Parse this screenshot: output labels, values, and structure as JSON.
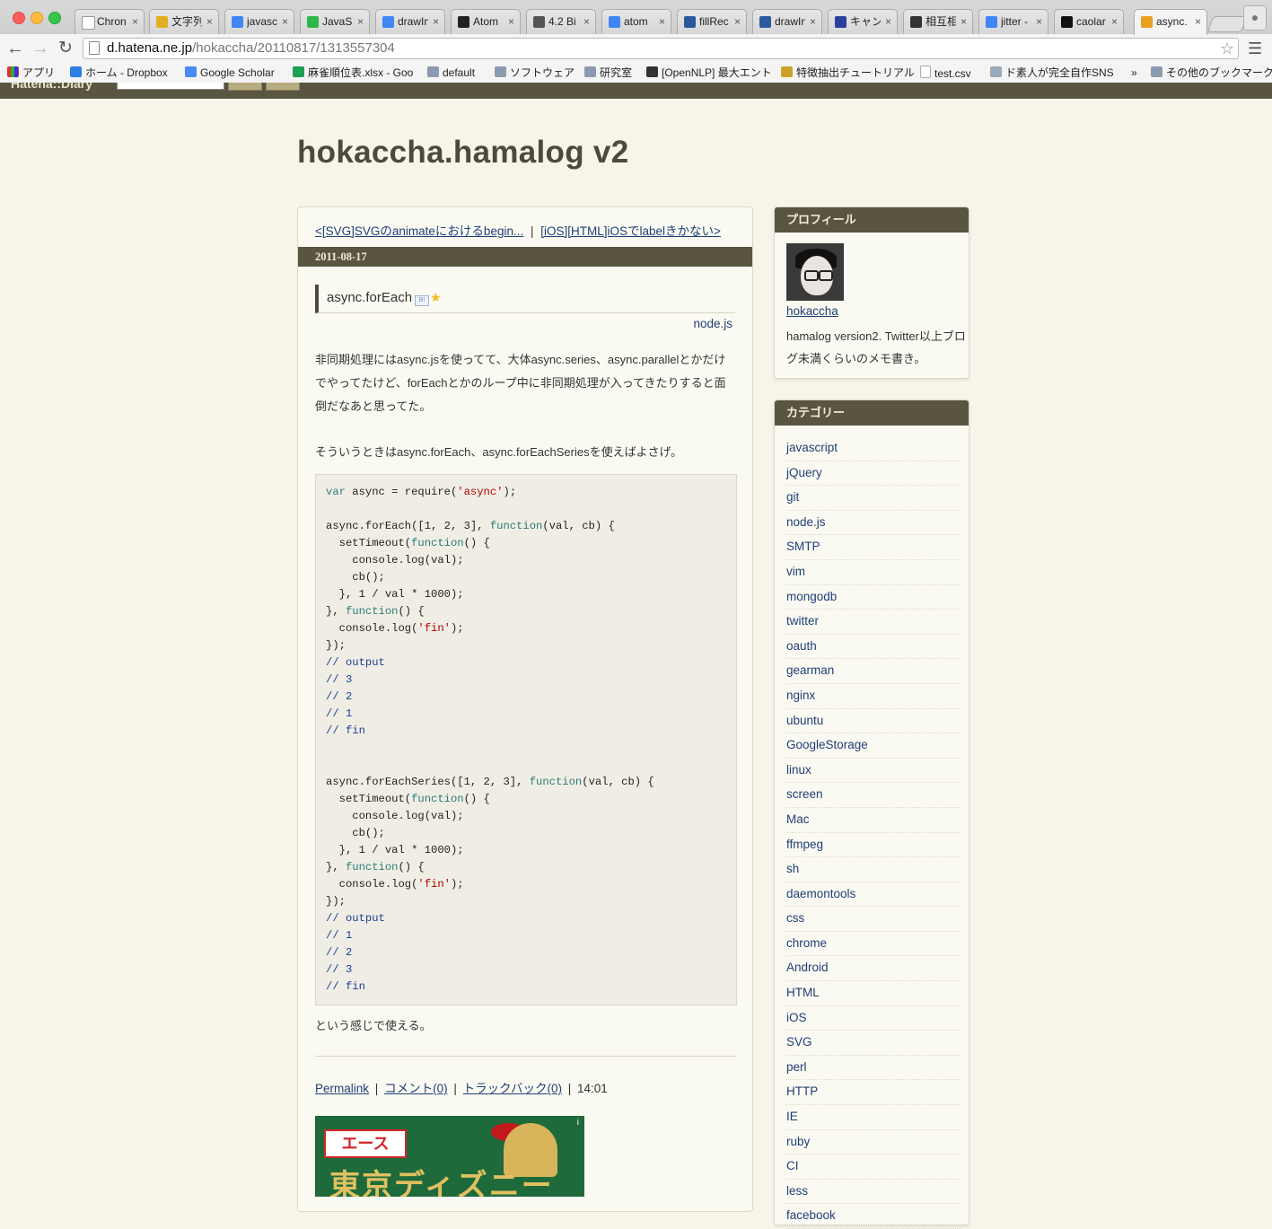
{
  "browser": {
    "tabs": [
      {
        "title": "Chron",
        "fav_color": "#ffffff"
      },
      {
        "title": "文字列",
        "fav_color": "#e0b020"
      },
      {
        "title": "javasc",
        "fav_color": "#4285f4"
      },
      {
        "title": "JavaS",
        "fav_color": "#2fb84a"
      },
      {
        "title": "drawIn",
        "fav_color": "#4285f4"
      },
      {
        "title": "Atom",
        "fav_color": "#222222"
      },
      {
        "title": "4.2 Bi",
        "fav_color": "#555555"
      },
      {
        "title": "atom",
        "fav_color": "#4285f4"
      },
      {
        "title": "fillRec",
        "fav_color": "#2b5a9c"
      },
      {
        "title": "drawIn",
        "fav_color": "#2b5a9c"
      },
      {
        "title": "キャン",
        "fav_color": "#2b3f9c"
      },
      {
        "title": "相互相",
        "fav_color": "#333333"
      },
      {
        "title": "jitter -",
        "fav_color": "#4285f4"
      },
      {
        "title": "caolar",
        "fav_color": "#111111"
      },
      {
        "title": "async.",
        "fav_color": "#e8a020"
      }
    ],
    "url_host": "d.hatena.ne.jp",
    "url_path": "/hokaccha/20110817/1313557304",
    "bookmarks": [
      "アプリ",
      "ホーム - Dropbox",
      "Google Scholar",
      "麻雀順位表.xlsx - Goo",
      "default",
      "ソフトウェア",
      "研究室",
      "[OpenNLP] 最大エント",
      "特徴抽出チュートリアル",
      "test.csv",
      "ド素人が完全自作SNS",
      "»",
      "その他のブックマーク"
    ]
  },
  "page": {
    "blog_title": "hokaccha.hamalog v2",
    "prev_link": "<[SVG]SVGのanimateにおけるbegin...",
    "pager_sep": "|",
    "next_link": "[iOS][HTML]iOSでlabelきかない>",
    "date": "2011-08-17",
    "entry_title": "async.forEach",
    "category": "node.js",
    "para1": "非同期処理にはasync.jsを使ってて、大体async.series、async.parallelとかだけでやってたけど、forEachとかのループ中に非同期処理が入ってきたりすると面倒だなあと思ってた。",
    "para2": "そういうときはasync.forEach、async.forEachSeriesを使えばよさげ。",
    "para3": "という感じで使える。",
    "code_lines": [
      "var async = require('async');",
      "",
      "async.forEach([1, 2, 3], function(val, cb) {",
      "  setTimeout(function() {",
      "    console.log(val);",
      "    cb();",
      "  }, 1 / val * 1000);",
      "}, function() {",
      "  console.log('fin');",
      "});",
      "// output",
      "// 3",
      "// 2",
      "// 1",
      "// fin",
      "",
      "",
      "async.forEachSeries([1, 2, 3], function(val, cb) {",
      "  setTimeout(function() {",
      "    console.log(val);",
      "    cb();",
      "  }, 1 / val * 1000);",
      "}, function() {",
      "  console.log('fin');",
      "});",
      "// output",
      "// 1",
      "// 2",
      "// 3",
      "// fin"
    ],
    "footer": {
      "permalink": "Permalink",
      "comment": "コメント(0)",
      "trackback": "トラックバック(0)",
      "sep": "|",
      "time": "14:01"
    },
    "ad": {
      "logo_text": "エース",
      "headline": "東京ディズニー"
    }
  },
  "sidebar": {
    "profile_header": "プロフィール",
    "profile_name": "hokaccha",
    "profile_desc": "hamalog version2. Twitter以上ブログ未満くらいのメモ書き。",
    "category_header": "カテゴリー",
    "categories": [
      "javascript",
      "jQuery",
      "git",
      "node.js",
      "SMTP",
      "vim",
      "mongodb",
      "twitter",
      "oauth",
      "gearman",
      "nginx",
      "ubuntu",
      "GoogleStorage",
      "linux",
      "screen",
      "Mac",
      "ffmpeg",
      "sh",
      "daemontools",
      "css",
      "chrome",
      "Android",
      "HTML",
      "iOS",
      "SVG",
      "perl",
      "HTTP",
      "IE",
      "ruby",
      "CI",
      "less",
      "facebook"
    ]
  },
  "colors": {
    "header_bar": "#5a5540",
    "page_bg": "#f7f5ea",
    "link": "#1f3f77"
  }
}
